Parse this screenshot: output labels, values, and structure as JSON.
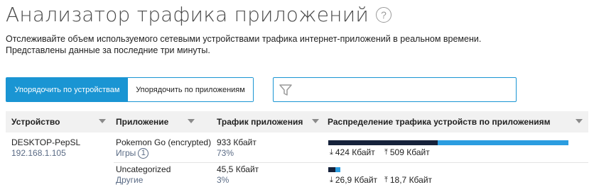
{
  "header": {
    "title": "Анализатор трафика приложений",
    "help_icon": "?"
  },
  "description": {
    "line1": "Отслеживайте объем используемого сетевыми устройствами трафика интернет-приложений в реальном времени.",
    "line2": "Представлены данные за последние три минуты."
  },
  "sort_toggle": {
    "by_devices": "Упорядочить по устройствам",
    "by_apps": "Упорядочить по приложениям",
    "active": "by_devices"
  },
  "filter": {
    "placeholder": "",
    "value": ""
  },
  "colors": {
    "accent": "#1a95d3",
    "bar_download": "#16223b",
    "bar_upload": "#2b9de0"
  },
  "table": {
    "columns": {
      "device": "Устройство",
      "app": "Приложение",
      "traffic": "Трафик приложения",
      "distribution": "Распределение трафика устройств по приложениям"
    },
    "device": {
      "name": "DESKTOP-PepSL",
      "ip": "192.168.1.105"
    },
    "rows": [
      {
        "app": "Pokemon Go (encrypted)",
        "category": "Игры",
        "badge": "1",
        "traffic": "933 Кбайт",
        "percent": "73%",
        "down": "424 Кбайт",
        "up": "509 Кбайт",
        "down_share": 0.4545,
        "up_share": 0.5455,
        "bar_scale": 1.0
      },
      {
        "app": "Uncategorized",
        "category": "Другие",
        "traffic": "45,5 Кбайт",
        "percent": "3%",
        "down": "26,9 Кбайт",
        "up": "18,7 Кбайт",
        "down_share": 0.59,
        "up_share": 0.41,
        "bar_scale": 0.0488
      }
    ]
  }
}
